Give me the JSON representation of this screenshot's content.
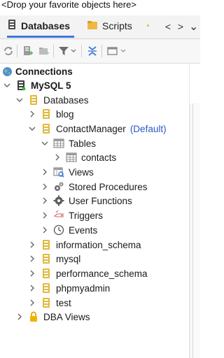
{
  "drop_hint": "<Drop your favorite objects here>",
  "tabs": [
    {
      "label": "Databases",
      "active": true,
      "icon": "database-icon"
    },
    {
      "label": "Scripts",
      "active": false,
      "icon": "scripts-icon"
    }
  ],
  "tab_nav": {
    "prev": "<",
    "next": ">",
    "menu": "⌄"
  },
  "toolbar": [
    {
      "icon": "refresh-icon"
    },
    {
      "icon": "new-document-icon"
    },
    {
      "icon": "new-folder-icon"
    },
    {
      "icon": "filter-icon"
    },
    {
      "icon": "filter-dropdown-icon"
    },
    {
      "icon": "collapse-all-icon"
    },
    {
      "icon": "window-icon"
    },
    {
      "icon": "window-dropdown-icon"
    }
  ],
  "tree": {
    "root_label": "Connections",
    "connection": {
      "label": "MySQL 5"
    },
    "databases_label": "Databases",
    "databases": [
      {
        "label": "blog",
        "expanded": false
      },
      {
        "label": "ContactManager",
        "default_tag": "(Default)",
        "expanded": true,
        "children": [
          {
            "label": "Tables",
            "expanded": true,
            "children": [
              {
                "label": "contacts"
              }
            ]
          },
          {
            "label": "Views"
          },
          {
            "label": "Stored Procedures"
          },
          {
            "label": "User Functions"
          },
          {
            "label": "Triggers"
          },
          {
            "label": "Events"
          }
        ]
      },
      {
        "label": "information_schema"
      },
      {
        "label": "mysql"
      },
      {
        "label": "performance_schema"
      },
      {
        "label": "phpmyadmin"
      },
      {
        "label": "test"
      }
    ],
    "dba_views": "DBA Views"
  },
  "colors": {
    "accent": "#3b78d8",
    "default_tag": "#2b57c8",
    "db_icon": "#e2b93b"
  }
}
